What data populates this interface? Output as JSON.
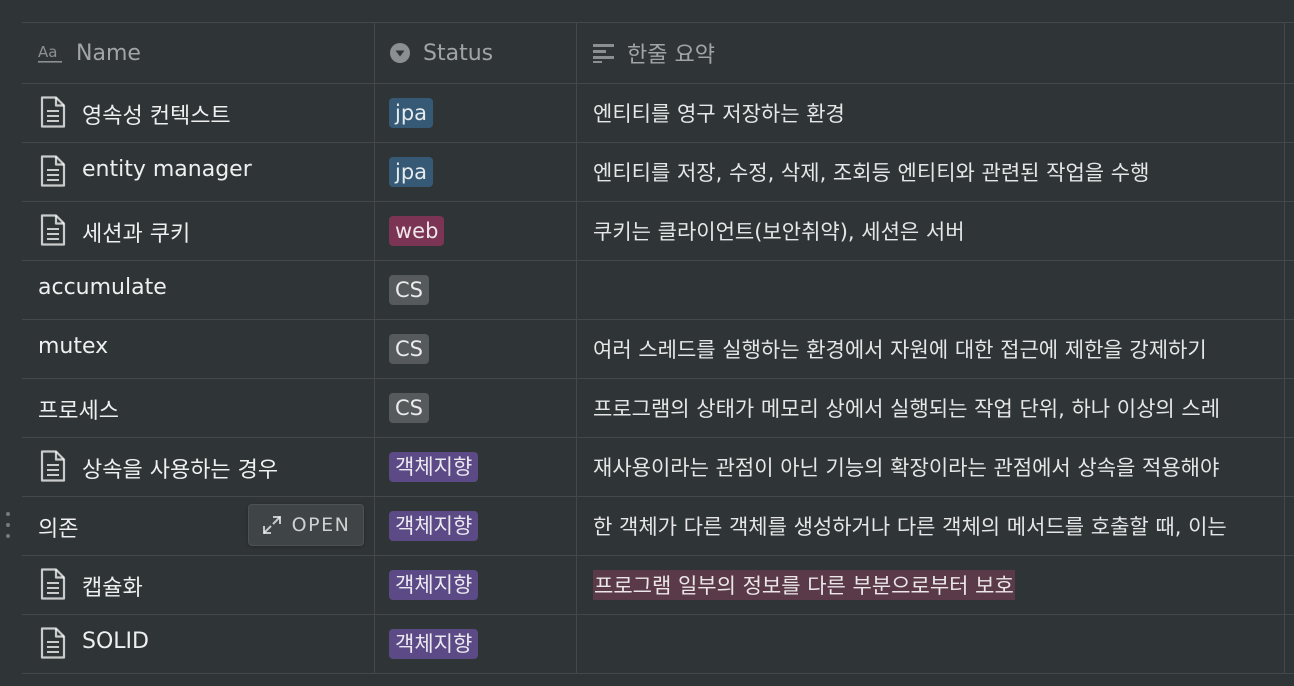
{
  "columns": {
    "name": "Name",
    "status": "Status",
    "summary": "한줄 요약"
  },
  "open_label": "OPEN",
  "rows": [
    {
      "name": "영속성 컨텍스트",
      "page_icon": true,
      "status": "jpa",
      "status_color": "#365a76",
      "summary": "엔티티를 영구 저장하는 환경"
    },
    {
      "name": "entity manager",
      "page_icon": true,
      "status": "jpa",
      "status_color": "#365a76",
      "summary": "엔티티를 저장, 수정, 삭제, 조회등 엔티티와 관련된 작업을 수행"
    },
    {
      "name": "세션과 쿠키",
      "page_icon": true,
      "status": "web",
      "status_color": "#7b3453",
      "summary": "쿠키는 클라이언트(보안취약), 세션은 서버"
    },
    {
      "name": "accumulate",
      "page_icon": false,
      "status": "CS",
      "status_color": "#565a5d",
      "summary": ""
    },
    {
      "name": "mutex",
      "page_icon": false,
      "status": "CS",
      "status_color": "#565a5d",
      "summary": "여러 스레드를 실행하는 환경에서 자원에 대한 접근에 제한을 강제하기"
    },
    {
      "name": "프로세스",
      "page_icon": false,
      "status": "CS",
      "status_color": "#565a5d",
      "summary": "프로그램의 상태가 메모리 상에서 실행되는 작업 단위, 하나 이상의 스레"
    },
    {
      "name": "상속을 사용하는 경우",
      "page_icon": true,
      "status": "객체지향",
      "status_color": "#5b4a86",
      "summary": "재사용이라는 관점이 아닌 기능의 확장이라는 관점에서 상속을 적용해야"
    },
    {
      "name": "의존",
      "page_icon": false,
      "status": "객체지향",
      "status_color": "#5b4a86",
      "summary": "한 객체가 다른 객체를 생성하거나 다른 객체의 메서드를 호출할 때, 이는"
    },
    {
      "name": "캡슐화",
      "page_icon": true,
      "status": "객체지향",
      "status_color": "#5b4a86",
      "summary": "프로그램 일부의 정보를 다른 부분으로부터 보호",
      "summary_highlight": "#5a3a48"
    },
    {
      "name": "SOLID",
      "page_icon": true,
      "status": "객체지향",
      "status_color": "#5b4a86",
      "summary": ""
    }
  ]
}
